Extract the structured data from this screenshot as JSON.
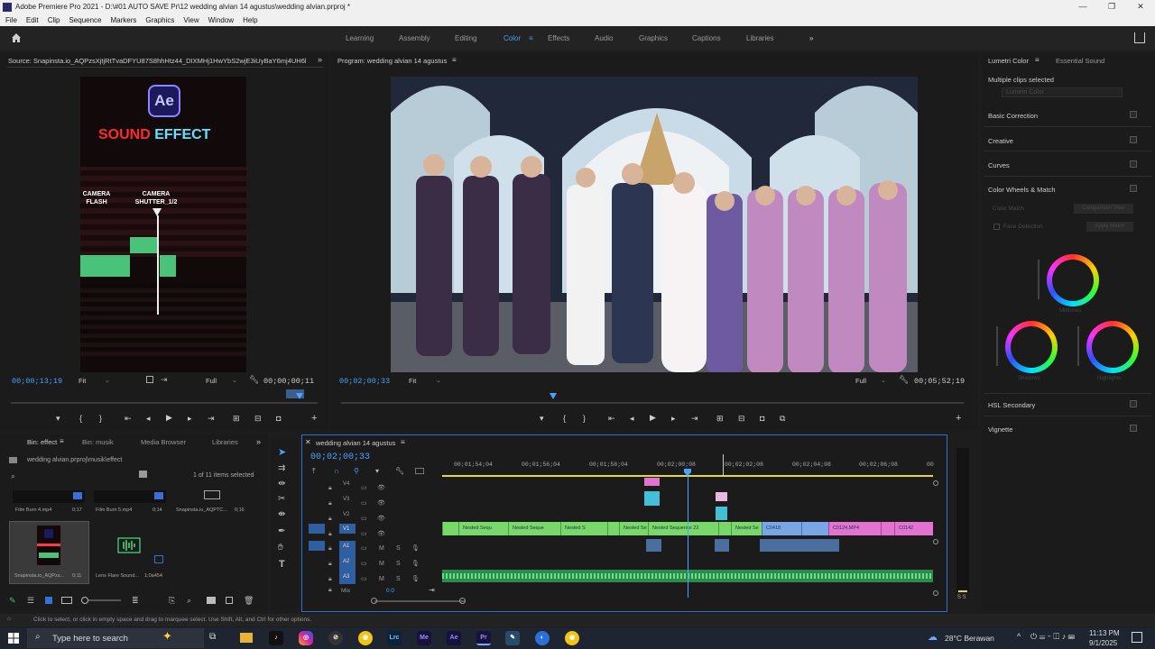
{
  "window": {
    "title": "Adobe Premiere Pro 2021 - D:\\#01 AUTO SAVE Pr\\12 wedding alvian 14 agustus\\wedding alvian.prproj *",
    "controls": [
      "—",
      "❐",
      "✕"
    ]
  },
  "menu": [
    "File",
    "Edit",
    "Clip",
    "Sequence",
    "Markers",
    "Graphics",
    "View",
    "Window",
    "Help"
  ],
  "workspaces": [
    "Learning",
    "Assembly",
    "Editing",
    "Color",
    "Effects",
    "Audio",
    "Graphics",
    "Captions",
    "Libraries"
  ],
  "active_workspace": "Color",
  "source": {
    "tab": "Source: Snapinsta.io_AQPzsXjtjRtTvaDFYU87S8hhHtz44_DIXMHj1HwYbS2wjE3iUyBaY6mj4UH6bfip",
    "timecode": "00;00;13;19",
    "fit": "Fit",
    "quality": "Full",
    "duration": "00;00;00;11",
    "thumb": {
      "ae_label": "Ae",
      "heading_a": "SOUND",
      "heading_b": " EFFECT",
      "label_left": "CAMERA FLASH",
      "label_right": "CAMERA SHUTTER_1/2"
    }
  },
  "program": {
    "tab": "Program: wedding alvian 14 agustus",
    "timecode": "00;02;00;33",
    "fit": "Fit",
    "quality": "Full",
    "duration": "00;05;52;19"
  },
  "project": {
    "tabs": [
      "Bin: effect",
      "Bin: musik",
      "Media Browser",
      "Libraries"
    ],
    "path": "wedding alvian.prproj\\musik\\effect",
    "count": "1 of 11 items selected",
    "items": [
      {
        "name": "Film Burn 4.mp4",
        "dur": "0;17"
      },
      {
        "name": "Film Burn 5.mp4",
        "dur": "0;14"
      },
      {
        "name": "Snapinsta.io_AQPTC...",
        "dur": "0;16"
      },
      {
        "name": "Snapinsta.io_AQPzs...",
        "dur": "0;11"
      },
      {
        "name": "Lens Flare Sound...",
        "dur": "1;0a454"
      }
    ]
  },
  "timeline": {
    "tab": "wedding alvian 14 agustus",
    "timecode": "00;02;00;33",
    "ruler": [
      "00;01;54;04",
      "00;01;56;04",
      "00;01;58;04",
      "00;02;00;08",
      "00;02;02;08",
      "00;02;04;08",
      "00;02;06;08",
      "00"
    ],
    "video_tracks": [
      "V4",
      "V3",
      "V2",
      "V1"
    ],
    "audio_tracks": [
      "A1",
      "A2",
      "A3"
    ],
    "v1_clips": [
      "Nested Sequ",
      "Nested Seque",
      "Nested S",
      "Nested Se",
      "Nested Sequence 22",
      "Nested Se",
      "C0418",
      "C0124.MP4",
      "C0142"
    ],
    "mix_label": "Mix",
    "mix_value": "0.0",
    "meter_label": "S S"
  },
  "lumetri": {
    "tabs": [
      "Lumetri Color",
      "Essential Sound"
    ],
    "selection": "Multiple clips selected",
    "master_placeholder": "Lumetri Color",
    "sections": [
      "Basic Correction",
      "Creative",
      "Curves",
      "Color Wheels & Match",
      "HSL Secondary",
      "Vignette"
    ],
    "color_match": "Color Match",
    "comparison": "Comparison View",
    "face_detection": "Face Detection",
    "apply_match": "Apply Match",
    "wheels": [
      "Midtones",
      "Shadows",
      "Highlights"
    ]
  },
  "status_bar": "Click to select, or click in empty space and drag to marquee select. Use Shift, Alt, and Ctrl for other options.",
  "taskbar": {
    "search": "Type here to search",
    "weather": "28°C  Berawan",
    "time": "11:13 PM",
    "date": "9/1/2025",
    "app_labels": [
      "Lrc",
      "Me",
      "Ae",
      "Pr"
    ]
  }
}
